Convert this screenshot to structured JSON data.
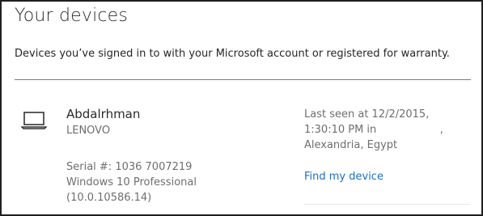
{
  "header": {
    "title": "Your devices"
  },
  "intro": {
    "text": "Devices you’ve signed in to with your Microsoft account or registered for warranty."
  },
  "device": {
    "icon": "laptop-icon",
    "name": "Abdalrhman",
    "manufacturer": "LENOVO",
    "serial": "Serial #: 1036     7007219",
    "os": "Windows 10 Professional",
    "os_version": "(10.0.10586.14)",
    "last_seen_line1": "Last seen at 12/2/2015,",
    "last_seen_line2": "1:30:10 PM in                   ,",
    "last_seen_line3": "Alexandria, Egypt",
    "find_link": "Find my device"
  },
  "colors": {
    "link": "#1a6fc4",
    "muted": "#6e6e6e",
    "text": "#262626"
  }
}
